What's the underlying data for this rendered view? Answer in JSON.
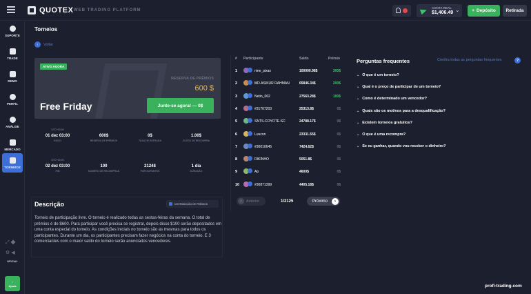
{
  "header": {
    "logo": "QUOTEX",
    "platform_label": "WEB TRADING PLATFORM",
    "account_type": "CONTA REAL",
    "balance": "$1,406.49",
    "deposit_label": "Depósito",
    "withdraw_label": "Retirada"
  },
  "sidebar": {
    "items": [
      {
        "label": "SUPORTE",
        "icon": "question-icon"
      },
      {
        "label": "TRADE",
        "icon": "chart-icon"
      },
      {
        "label": "DEMO",
        "icon": "cap-icon"
      },
      {
        "label": "PERFIL",
        "icon": "user-icon"
      },
      {
        "label": "ANÁLISE",
        "icon": "analysis-icon"
      },
      {
        "label": "MERCADO",
        "icon": "market-icon"
      },
      {
        "label": "TORNEIOS",
        "icon": "trophy-icon"
      }
    ],
    "official_label": "OFICIAL",
    "help_label": "Ajuda"
  },
  "page": {
    "title": "Torneios",
    "back_label": "Voltar"
  },
  "tournament": {
    "status": "ATIVO AGORA",
    "prize_label": "RESERVA DE PRÊMIOS",
    "prize_value": "600 $",
    "name": "Free Friday",
    "join_label": "Junte-se agora! — 0$"
  },
  "stats": [
    {
      "cap": "UTC+03:00",
      "val": "01 dez 03:00",
      "sub": "INÍCIO"
    },
    {
      "cap": "",
      "val": "600$",
      "sub": "RESERVA DE PRÊMIOS"
    },
    {
      "cap": "",
      "val": "0$",
      "sub": "TAXA DE ENTRADA"
    },
    {
      "cap": "",
      "val": "1.00$",
      "sub": "CUSTO DE RECOMPRA"
    },
    {
      "cap": "UTC+03:00",
      "val": "02 dez 03:00",
      "sub": "FIM"
    },
    {
      "cap": "",
      "val": "100",
      "sub": "NÚMERO DE RECOMPRAS"
    },
    {
      "cap": "",
      "val": "21248",
      "sub": "PARTICIPANTES"
    },
    {
      "cap": "",
      "val": "1 dia",
      "sub": "DURAÇÃO"
    }
  ],
  "description": {
    "title": "Descrição",
    "distribution_label": "DISTRIBUIÇÃO DE PRÊMIOS",
    "text": "Torneio de participação livre. O torneio é realizado todas as sextas-feiras da semana. O total de prêmios é de $600. Para participar você precisa se registrar, depois disso $100 serão depositados em uma conta especial do torneio. As condições iniciais no torneio são as mesmas para todos os participantes. Durante um dia, os participantes precisam fazer negócios na conta do torneio. E 3 comerciantes com o maior saldo do torneio serão anunciados vencedores."
  },
  "leaderboard": {
    "headers": [
      "#",
      "Participante",
      "Saldo",
      "Prêmio"
    ],
    "rows": [
      {
        "n": "1",
        "name": "nine_pixas",
        "balance": "100000.98$",
        "prize": "300$"
      },
      {
        "n": "2",
        "name": "MD.ASIKUR RAHMAN",
        "balance": "65846.34$",
        "prize": "200$"
      },
      {
        "n": "3",
        "name": "Netin_062",
        "balance": "27563.28$",
        "prize": "100$"
      },
      {
        "n": "4",
        "name": "#31707203",
        "balance": "25313.8$",
        "prize": "0$"
      },
      {
        "n": "5",
        "name": "SNTS-COYOTE-SC",
        "balance": "24788.17$",
        "prize": "0$"
      },
      {
        "n": "6",
        "name": "Luucon",
        "balance": "23331.55$",
        "prize": "0$"
      },
      {
        "n": "7",
        "name": "#30010645",
        "balance": "7424.62$",
        "prize": "0$"
      },
      {
        "n": "8",
        "name": "RIKINHO",
        "balance": "5051.8$",
        "prize": "0$"
      },
      {
        "n": "9",
        "name": "Ap",
        "balance": "4600$",
        "prize": "0$"
      },
      {
        "n": "10",
        "name": "#30871399",
        "balance": "4405.18$",
        "prize": "0$"
      }
    ],
    "prev_label": "Anterior",
    "page_indicator": "1/2125",
    "next_label": "Próximo"
  },
  "faq": {
    "title": "Perguntas frequentes",
    "link": "Confira todas as perguntas frequentes",
    "items": [
      "O que é um torneio?",
      "Qual é o preço de participar de um torneio?",
      "Como é determinado um vencedor?",
      "Quais são os motivos para a desqualificação?",
      "Existem torneios gratuitos?",
      "O que é uma recompra?",
      "Se eu ganhar, quando vou receber o dinheiro?"
    ]
  },
  "watermark": "profi-trading.com",
  "colors": {
    "accent": "#3e6fd8",
    "success": "#3ab15c",
    "prize": "#e4b84e",
    "background": "#1c1f2d"
  }
}
